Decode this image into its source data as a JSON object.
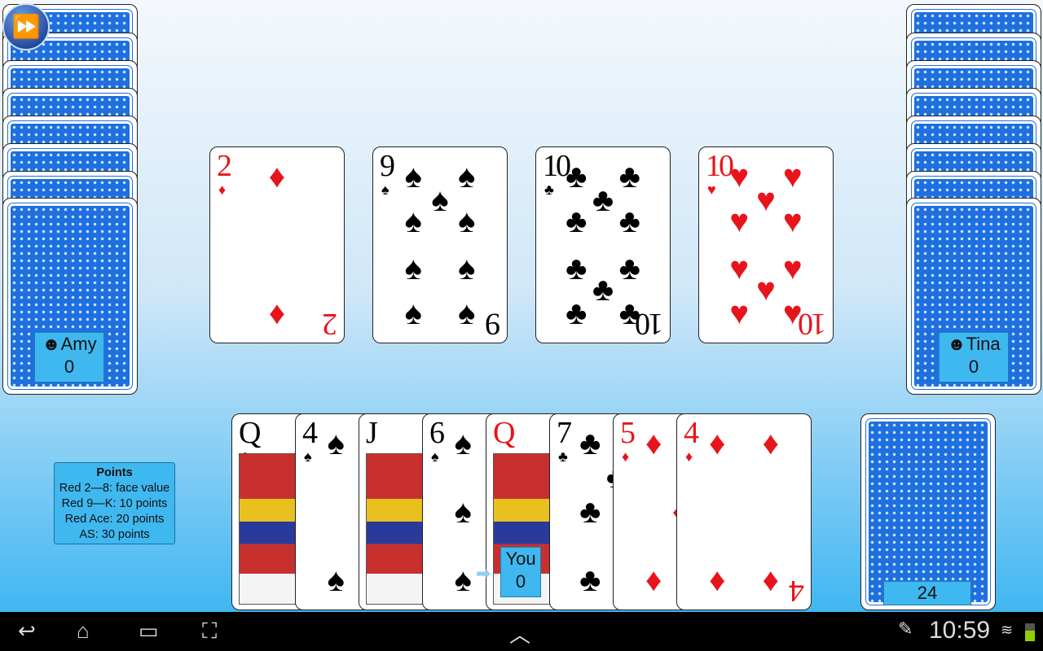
{
  "players": {
    "left": {
      "name": "Amy",
      "score": "0",
      "icon": "smiley-icon"
    },
    "right": {
      "name": "Tina",
      "score": "0",
      "icon": "smiley-icon"
    },
    "you": {
      "name": "You",
      "score": "0"
    }
  },
  "fast_forward_icon": "fast-forward-icon",
  "trick": [
    {
      "rank": "2",
      "suit": "♦",
      "color": "red"
    },
    {
      "rank": "9",
      "suit": "♠",
      "color": "blk"
    },
    {
      "rank": "10",
      "suit": "♣",
      "color": "blk"
    },
    {
      "rank": "10",
      "suit": "♥",
      "color": "red"
    }
  ],
  "hand": [
    {
      "rank": "Q",
      "suit": "♣",
      "color": "blk"
    },
    {
      "rank": "4",
      "suit": "♠",
      "color": "blk"
    },
    {
      "rank": "J",
      "suit": "♠",
      "color": "blk"
    },
    {
      "rank": "6",
      "suit": "♠",
      "color": "blk"
    },
    {
      "rank": "Q",
      "suit": "♦",
      "color": "red"
    },
    {
      "rank": "7",
      "suit": "♣",
      "color": "blk"
    },
    {
      "rank": "5",
      "suit": "♦",
      "color": "red"
    },
    {
      "rank": "4",
      "suit": "♦",
      "color": "red"
    }
  ],
  "deck_count": "24",
  "points": {
    "title": "Points",
    "lines": [
      "Red 2—8: face value",
      "Red 9—K: 10 points",
      "Red Ace: 20 points",
      "AS: 30 points"
    ]
  },
  "status_bar": {
    "time": "10:59"
  }
}
